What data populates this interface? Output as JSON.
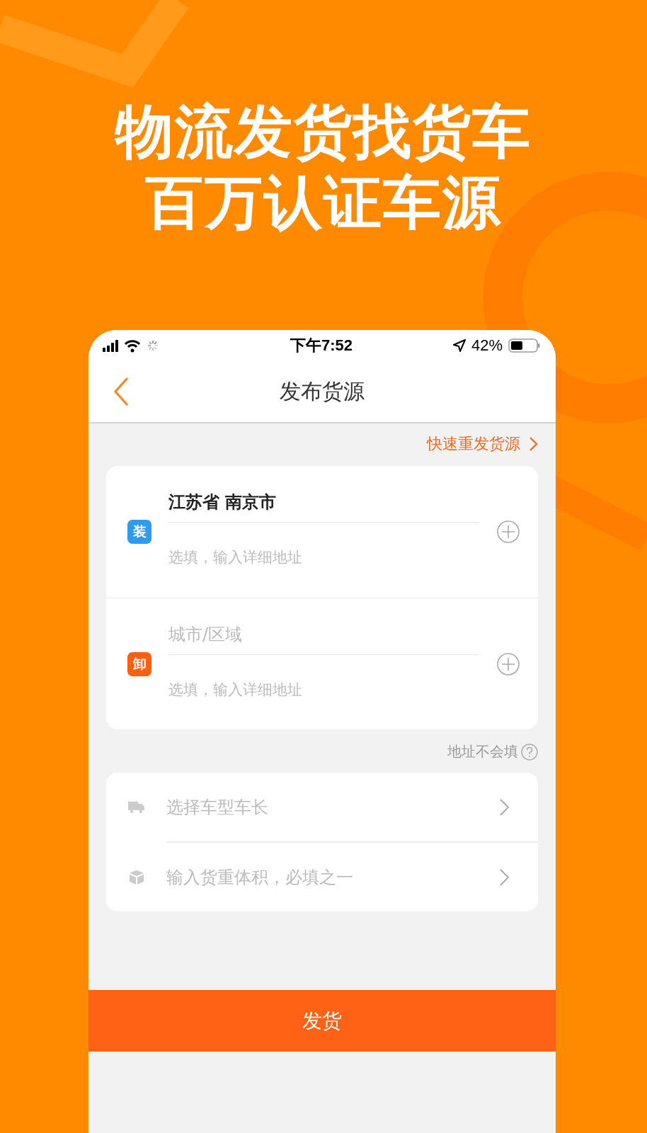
{
  "headline": [
    "物流发货找货车",
    "百万认证车源"
  ],
  "status_bar": {
    "time": "下午7:52",
    "battery": "42%"
  },
  "nav": {
    "title": "发布货源"
  },
  "quick_repost": {
    "label": "快速重发货源"
  },
  "route": [
    {
      "badge": "装",
      "color": "#2e9bf0",
      "city": {
        "value": "江苏省 南京市"
      },
      "detail": {
        "placeholder": "选填，输入详细地址"
      }
    },
    {
      "badge": "卸",
      "color": "#ff6010",
      "city": {
        "placeholder": "城市/区域"
      },
      "detail": {
        "placeholder": "选填，输入详细地址"
      }
    }
  ],
  "address_help": {
    "label": "地址不会填"
  },
  "options": [
    {
      "kind": "truck",
      "placeholder": "选择车型车长"
    },
    {
      "kind": "cargo",
      "placeholder": "输入货重体积，必填之一"
    }
  ],
  "submit": {
    "label": "发货"
  }
}
